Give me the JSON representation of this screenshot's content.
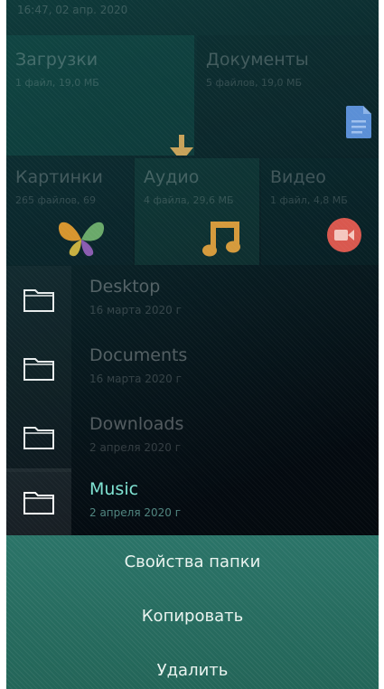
{
  "status_bar": {
    "time_date": "16:47, 02 апр. 2020"
  },
  "tiles": {
    "downloads": {
      "title": "Загрузки",
      "subtitle": "1 файл, 19,0 МБ",
      "icon": "download-arrow-icon"
    },
    "documents": {
      "title": "Документы",
      "subtitle": "5 файлов, 19,0 МБ",
      "icon": "document-icon"
    },
    "pictures": {
      "title": "Картинки",
      "subtitle": "265 файлов, 69",
      "icon": "butterfly-icon"
    },
    "audio": {
      "title": "Аудио",
      "subtitle": "4 файла, 29,6 МБ",
      "icon": "music-note-icon"
    },
    "video": {
      "title": "Видео",
      "subtitle": "1 файл, 4,8 МБ",
      "icon": "video-camera-icon"
    }
  },
  "folders": [
    {
      "name": "Desktop",
      "date": "16 марта 2020 г"
    },
    {
      "name": "Documents",
      "date": "16 марта 2020 г"
    },
    {
      "name": "Downloads",
      "date": "2 апреля 2020 г"
    },
    {
      "name": "Music",
      "date": "2 апреля 2020 г"
    }
  ],
  "context_menu": {
    "items": [
      "Свойства папки",
      "Копировать",
      "Удалить"
    ]
  },
  "colors": {
    "highlight_text": "#7fe3d3",
    "menu_background": "#2b7468",
    "download_icon": "#c7a25a",
    "document_icon": "#5b8fd6",
    "music_icon": "#d59a3c",
    "video_icon": "#d9584e"
  }
}
